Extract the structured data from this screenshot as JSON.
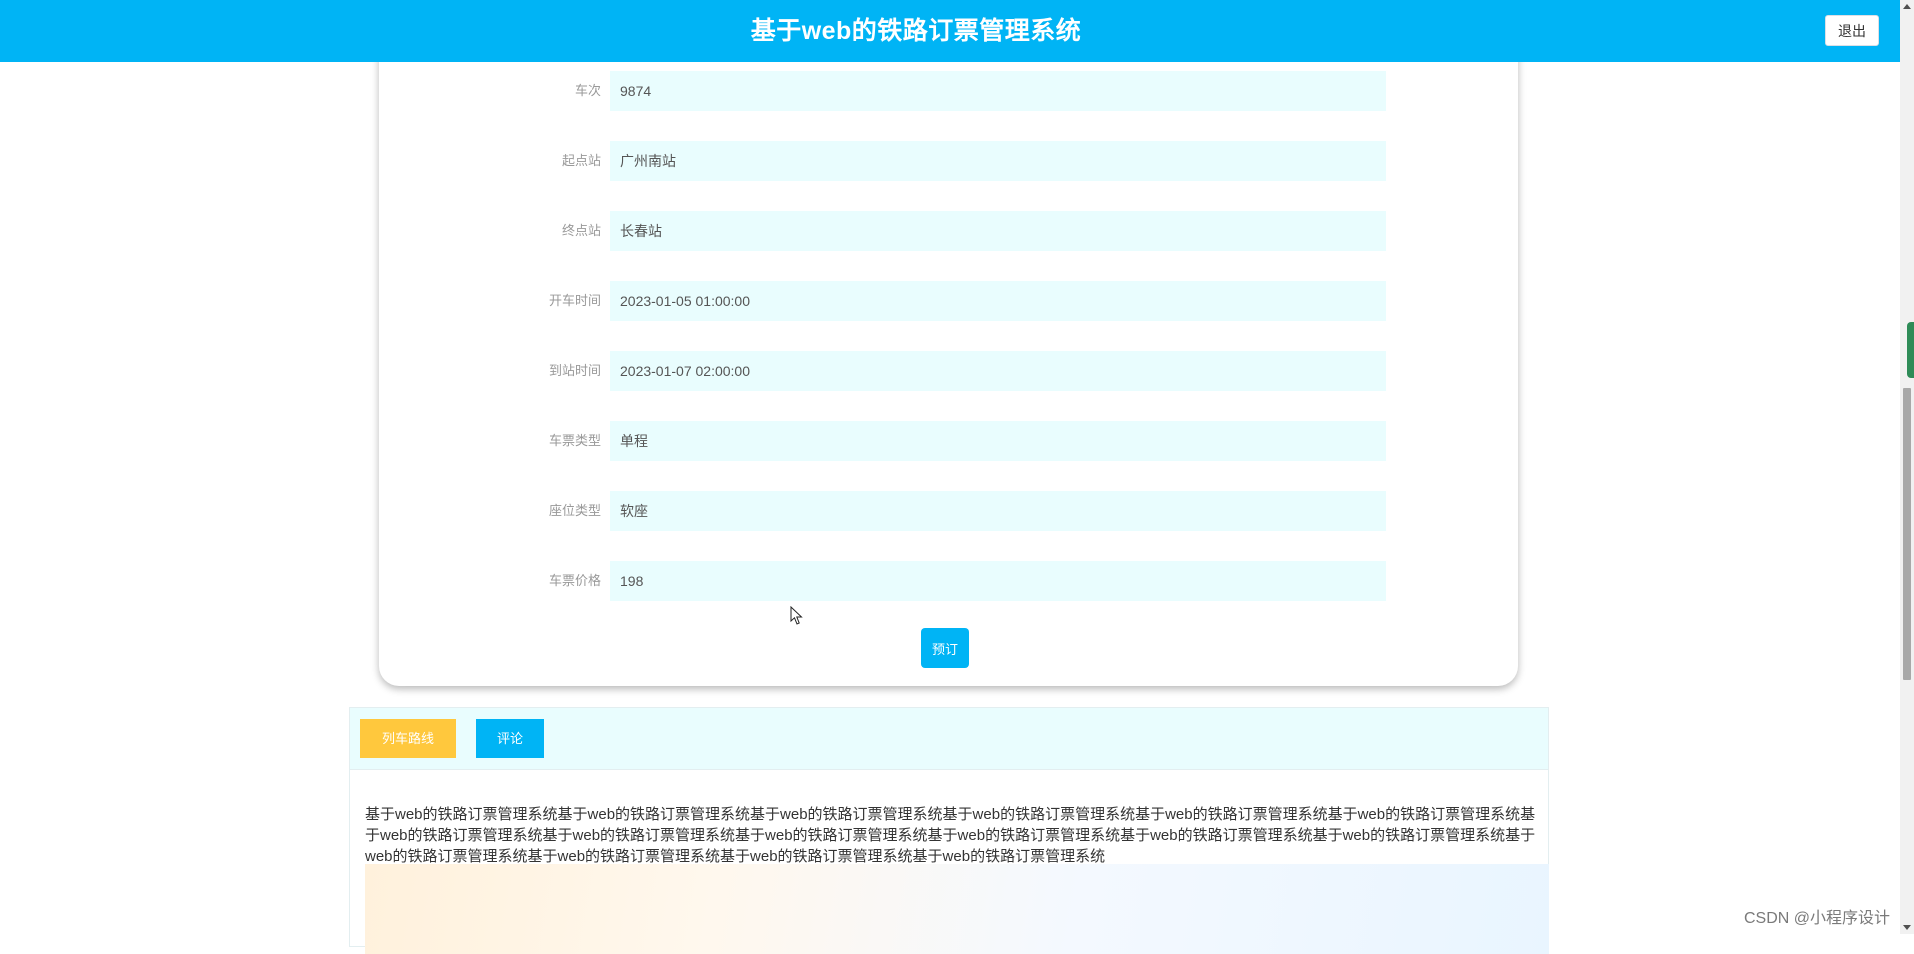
{
  "header": {
    "title": "基于web的铁路订票管理系统",
    "logout_label": "退出",
    "background_color": "#00b4f5"
  },
  "form": {
    "fields": [
      {
        "label": "车次",
        "value": "9874"
      },
      {
        "label": "起点站",
        "value": "广州南站"
      },
      {
        "label": "终点站",
        "value": "长春站"
      },
      {
        "label": "开车时间",
        "value": "2023-01-05 01:00:00"
      },
      {
        "label": "到站时间",
        "value": "2023-01-07 02:00:00"
      },
      {
        "label": "车票类型",
        "value": "单程"
      },
      {
        "label": "座位类型",
        "value": "软座"
      },
      {
        "label": "车票价格",
        "value": "198"
      }
    ],
    "book_label": "预订"
  },
  "tabs": {
    "items": [
      {
        "label": "列车路线",
        "color": "#ffc83d"
      },
      {
        "label": "评论",
        "color": "#00b4f5"
      }
    ],
    "content_text": "基于web的铁路订票管理系统基于web的铁路订票管理系统基于web的铁路订票管理系统基于web的铁路订票管理系统基于web的铁路订票管理系统基于web的铁路订票管理系统基于web的铁路订票管理系统基于web的铁路订票管理系统基于web的铁路订票管理系统基于web的铁路订票管理系统基于web的铁路订票管理系统基于web的铁路订票管理系统基于web的铁路订票管理系统基于web的铁路订票管理系统基于web的铁路订票管理系统基于web的铁路订票管理系统"
  },
  "watermark": "CSDN @小程序设计"
}
